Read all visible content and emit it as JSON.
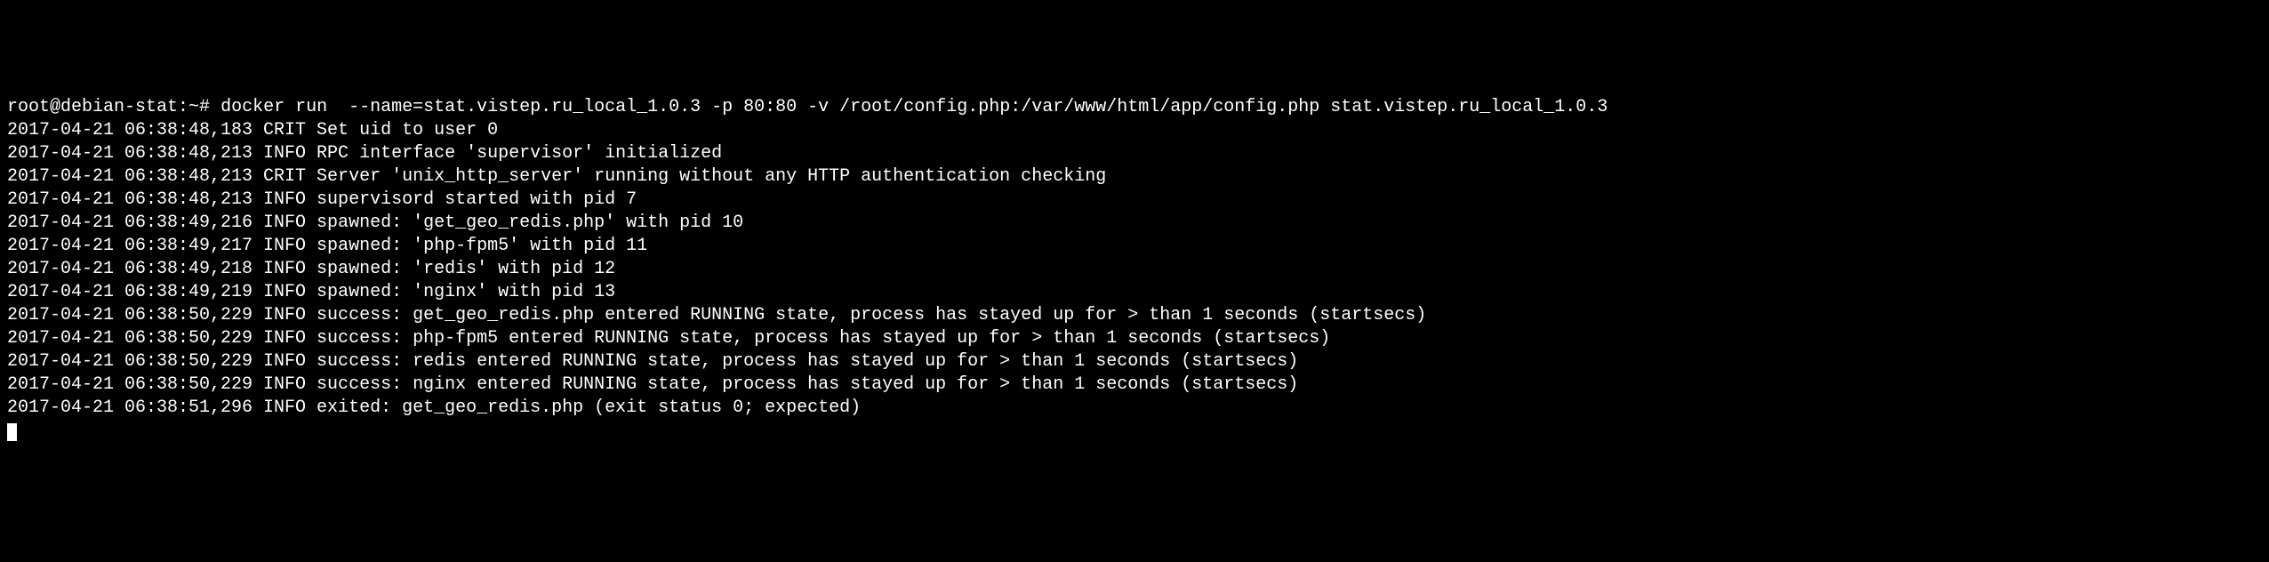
{
  "terminal": {
    "prompt_user_host": "root@debian-stat:~#",
    "command": "docker run  --name=stat.vistep.ru_local_1.0.3 -p 80:80 -v /root/config.php:/var/www/html/app/config.php stat.vistep.ru_local_1.0.3",
    "log_lines": [
      "2017-04-21 06:38:48,183 CRIT Set uid to user 0",
      "2017-04-21 06:38:48,213 INFO RPC interface 'supervisor' initialized",
      "2017-04-21 06:38:48,213 CRIT Server 'unix_http_server' running without any HTTP authentication checking",
      "2017-04-21 06:38:48,213 INFO supervisord started with pid 7",
      "2017-04-21 06:38:49,216 INFO spawned: 'get_geo_redis.php' with pid 10",
      "2017-04-21 06:38:49,217 INFO spawned: 'php-fpm5' with pid 11",
      "2017-04-21 06:38:49,218 INFO spawned: 'redis' with pid 12",
      "2017-04-21 06:38:49,219 INFO spawned: 'nginx' with pid 13",
      "2017-04-21 06:38:50,229 INFO success: get_geo_redis.php entered RUNNING state, process has stayed up for > than 1 seconds (startsecs)",
      "2017-04-21 06:38:50,229 INFO success: php-fpm5 entered RUNNING state, process has stayed up for > than 1 seconds (startsecs)",
      "2017-04-21 06:38:50,229 INFO success: redis entered RUNNING state, process has stayed up for > than 1 seconds (startsecs)",
      "2017-04-21 06:38:50,229 INFO success: nginx entered RUNNING state, process has stayed up for > than 1 seconds (startsecs)",
      "2017-04-21 06:38:51,296 INFO exited: get_geo_redis.php (exit status 0; expected)"
    ]
  }
}
